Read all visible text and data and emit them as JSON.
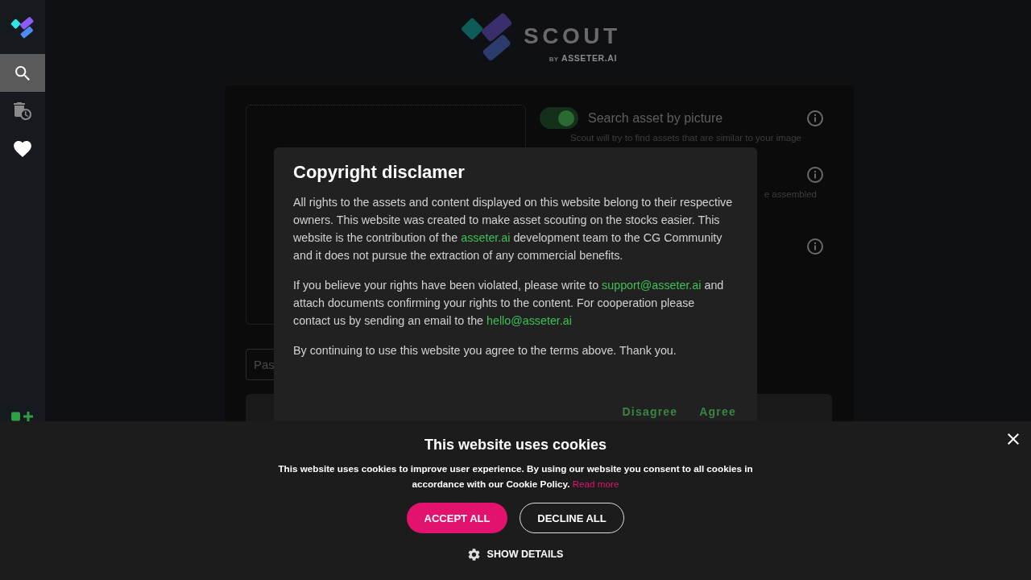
{
  "sidebar": {
    "items": [
      {
        "selected": true,
        "disabled": false
      },
      {
        "selected": false,
        "disabled": true
      },
      {
        "selected": false,
        "disabled": false
      }
    ]
  },
  "logo": {
    "name": "SCOUT",
    "by": "BY",
    "company": "ASSETER.AI"
  },
  "search_panel": {
    "options": [
      {
        "kind": "toggle",
        "on": true,
        "title": "Search asset by picture",
        "note": "Scout will try to find assets that are similar to your image"
      },
      {
        "kind": "note",
        "note": "e assembled"
      },
      {
        "kind": "info"
      }
    ],
    "url_field": {
      "placeholder": "Pas"
    }
  },
  "dialog": {
    "title": "Copyright disclamer",
    "paragraphs": [
      [
        {
          "kind": "text",
          "text": "All rights to the assets and content displayed on this website belong to their respective owners. This website was created to make asset scouting on the stocks easier. This website is the contribution of the "
        },
        {
          "kind": "link",
          "text": "asseter.ai"
        },
        {
          "kind": "text",
          "text": " development team to the CG Community and it does not pursue the extraction of any commercial benefits."
        }
      ],
      [
        {
          "kind": "text",
          "text": "If you believe your rights have been violated, please write to "
        },
        {
          "kind": "link",
          "text": "support@asseter.ai"
        },
        {
          "kind": "text",
          "text": " and attach documents confirming your rights to the content. For cooperation please contact us by sending an email to the "
        },
        {
          "kind": "link",
          "text": "hello@asseter.ai"
        }
      ],
      [
        {
          "kind": "text",
          "text": "By continuing to use this website you agree to the terms above. Thank you."
        }
      ]
    ],
    "buttons": [
      "Disagree",
      "Agree"
    ]
  },
  "cookie_banner": {
    "title": "This website uses cookies",
    "text": "This website uses cookies to improve user experience. By using our website you consent to all cookies in accordance with our Cookie Policy.",
    "link": "Read more",
    "buttons": [
      {
        "kind": "primary",
        "label": "ACCEPT ALL"
      },
      {
        "kind": "outline",
        "label": "DECLINE ALL"
      }
    ],
    "details": "SHOW DETAILS"
  }
}
